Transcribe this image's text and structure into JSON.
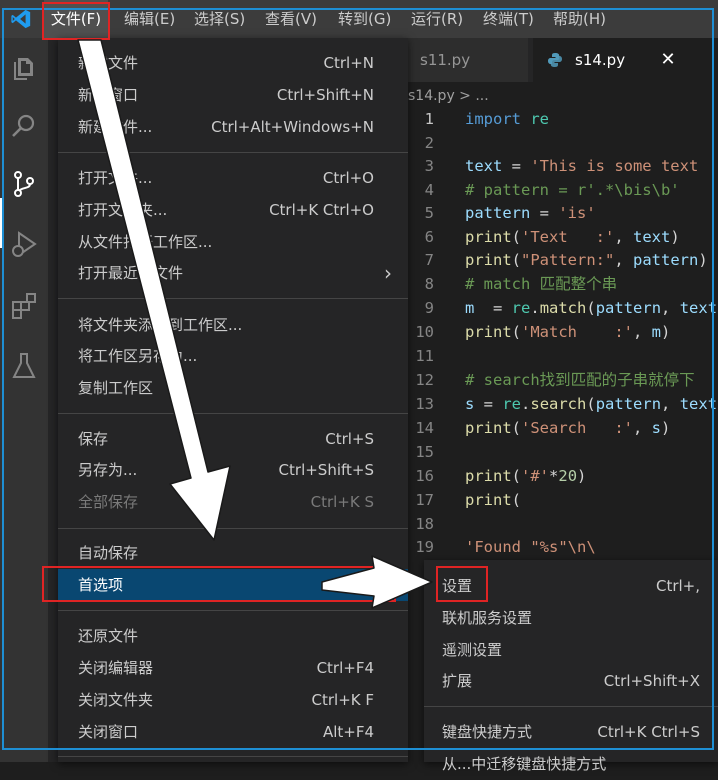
{
  "menubar": {
    "items": [
      "文件(F)",
      "编辑(E)",
      "选择(S)",
      "查看(V)",
      "转到(G)",
      "运行(R)",
      "终端(T)",
      "帮助(H)"
    ]
  },
  "tabs": [
    {
      "label": "s11.py"
    },
    {
      "label": "s14.py",
      "close": "✕"
    }
  ],
  "breadcrumb": "s14.py > ...",
  "editor": {
    "current_line": 1,
    "lines": [
      {
        "n": "1",
        "text": "import re"
      },
      {
        "n": "2",
        "text": ""
      },
      {
        "n": "3",
        "text": "text = 'This is some text"
      },
      {
        "n": "4",
        "text": "# pattern = r'.*\\bis\\b'"
      },
      {
        "n": "5",
        "text": "pattern = 'is'"
      },
      {
        "n": "6",
        "text": "print('Text   :', text)"
      },
      {
        "n": "7",
        "text": "print(\"Pattern:\", pattern)"
      },
      {
        "n": "8",
        "text": "# match 匹配整个串"
      },
      {
        "n": "9",
        "text": "m  = re.match(pattern, text"
      },
      {
        "n": "10",
        "text": "print('Match    :', m)"
      },
      {
        "n": "11",
        "text": ""
      },
      {
        "n": "12",
        "text": "# search找到匹配的子串就停下"
      },
      {
        "n": "13",
        "text": "s = re.search(pattern, text"
      },
      {
        "n": "14",
        "text": "print('Search   :', s)"
      },
      {
        "n": "15",
        "text": ""
      },
      {
        "n": "16",
        "text": "print('#'*20)"
      },
      {
        "n": "17",
        "text": "print("
      },
      {
        "n": "18",
        "text": ""
      },
      {
        "n": "19",
        "text": "'Found \"%s\"\\n\\"
      }
    ]
  },
  "file_menu": {
    "items": [
      {
        "label": "新建文件",
        "shortcut": "Ctrl+N"
      },
      {
        "label": "新建窗口",
        "shortcut": "Ctrl+Shift+N"
      },
      {
        "label": "新建文件...",
        "shortcut": "Ctrl+Alt+Windows+N"
      },
      {
        "label": "打开文件...",
        "shortcut": "Ctrl+O"
      },
      {
        "label": "打开文件夹...",
        "shortcut": "Ctrl+K Ctrl+O"
      },
      {
        "label": "从文件打开工作区...",
        "shortcut": ""
      },
      {
        "label": "打开最近的文件",
        "shortcut": "›"
      },
      {
        "label": "将文件夹添加到工作区...",
        "shortcut": ""
      },
      {
        "label": "将工作区另存为...",
        "shortcut": ""
      },
      {
        "label": "复制工作区",
        "shortcut": ""
      },
      {
        "label": "保存",
        "shortcut": "Ctrl+S"
      },
      {
        "label": "另存为...",
        "shortcut": "Ctrl+Shift+S"
      },
      {
        "label": "全部保存",
        "shortcut": "Ctrl+K S"
      },
      {
        "label": "自动保存",
        "shortcut": ""
      },
      {
        "label": "首选项",
        "shortcut": ""
      },
      {
        "label": "还原文件",
        "shortcut": ""
      },
      {
        "label": "关闭编辑器",
        "shortcut": "Ctrl+F4"
      },
      {
        "label": "关闭文件夹",
        "shortcut": "Ctrl+K F"
      },
      {
        "label": "关闭窗口",
        "shortcut": "Alt+F4"
      }
    ]
  },
  "preferences_submenu": {
    "items": [
      {
        "label": "设置",
        "shortcut": "Ctrl+,"
      },
      {
        "label": "联机服务设置",
        "shortcut": ""
      },
      {
        "label": "遥测设置",
        "shortcut": ""
      },
      {
        "label": "扩展",
        "shortcut": "Ctrl+Shift+X"
      },
      {
        "label": "键盘快捷方式",
        "shortcut": "Ctrl+K Ctrl+S"
      },
      {
        "label": "从...中迁移键盘快捷方式",
        "shortcut": ""
      }
    ]
  },
  "colors": {
    "highlight": "#094771",
    "annotation_red": "#e02424",
    "annotation_blue": "#1e8fd4",
    "arrow": "#ffffff"
  },
  "icons": [
    "vscode-logo-icon",
    "explorer-icon",
    "search-icon",
    "source-control-icon",
    "run-debug-icon",
    "extensions-icon",
    "testing-icon",
    "python-file-icon",
    "close-icon",
    "chevron-right-icon",
    "annotation-arrow"
  ]
}
